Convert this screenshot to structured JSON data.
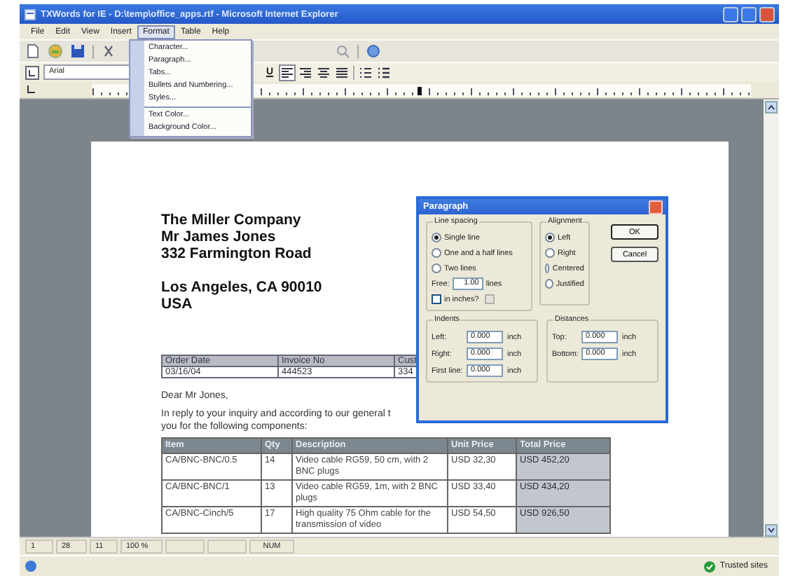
{
  "window": {
    "title": "TXWords for IE - D:\\temp\\office_apps.rtf - Microsoft Internet Explorer"
  },
  "menu_bar": [
    {
      "label": "File",
      "selected": false
    },
    {
      "label": "Edit",
      "selected": false
    },
    {
      "label": "View",
      "selected": false
    },
    {
      "label": "Insert",
      "selected": false
    },
    {
      "label": "Format",
      "selected": true
    },
    {
      "label": "Table",
      "selected": false
    },
    {
      "label": "Help",
      "selected": false
    }
  ],
  "format_menu": [
    {
      "kind": "item",
      "label": "Character..."
    },
    {
      "kind": "item",
      "label": "Paragraph..."
    },
    {
      "kind": "item",
      "label": "Tabs..."
    },
    {
      "kind": "item",
      "label": "Bullets and Numbering..."
    },
    {
      "kind": "item",
      "label": "Styles..."
    },
    {
      "kind": "separator"
    },
    {
      "kind": "item",
      "label": "Text Color..."
    },
    {
      "kind": "item",
      "label": "Background Color..."
    }
  ],
  "format_toolbar": {
    "font": "Arial",
    "underline": "U"
  },
  "document": {
    "address_lines": [
      "The Miller Company",
      "Mr James Jones",
      "332 Farmington Road"
    ],
    "city_lines": [
      "Los Angeles, CA 90010",
      "USA"
    ],
    "info_table": {
      "columns": [
        "Order Date",
        "Invoice No",
        "Cust"
      ],
      "rows": [
        [
          "03/16/04",
          "444523",
          "334"
        ]
      ]
    },
    "salutation": "Dear Mr Jones,",
    "intro_lines": [
      "In reply to your inquiry and according to our general t",
      "you for the following components:"
    ],
    "items_table": {
      "columns": [
        "Item",
        "Qty",
        "Description",
        "Unit Price",
        "Total Price"
      ],
      "rows": [
        [
          "CA/BNC-BNC/0.5",
          "14",
          "Video cable RG59, 50 cm, with 2 BNC plugs",
          "USD 32,30",
          "USD 452,20"
        ],
        [
          "CA/BNC-BNC/1",
          "13",
          "Video cable RG59, 1m, with 2 BNC plugs",
          "USD 33,40",
          "USD 434,20"
        ],
        [
          "CA/BNC-Cinch/5",
          "17",
          "High quality 75 Ohm cable for the transmission of video",
          "USD 54,50",
          "USD 926,50"
        ]
      ]
    }
  },
  "dialog": {
    "title": "Paragraph",
    "line_spacing": {
      "label": "Line spacing",
      "options": [
        {
          "label": "Single line",
          "selected": true
        },
        {
          "label": "One and a half lines",
          "selected": false
        },
        {
          "label": "Two lines",
          "selected": false
        }
      ],
      "free_label": "Free:",
      "free_value": "1.00",
      "free_unit": "lines",
      "in_inches": {
        "label": "in inches?",
        "checked": false
      },
      "exact": {
        "disabled": true
      }
    },
    "alignment": {
      "label": "Alignment",
      "options": [
        {
          "label": "Left",
          "selected": true
        },
        {
          "label": "Right",
          "selected": false
        },
        {
          "label": "Centered",
          "selected": false
        },
        {
          "label": "Justified",
          "selected": false
        }
      ]
    },
    "buttons": [
      "OK",
      "Cancel"
    ],
    "indents": {
      "label": "Indents",
      "fields": [
        {
          "label": "Left:",
          "value": "0.000",
          "unit": "inch"
        },
        {
          "label": "Right:",
          "value": "0.000",
          "unit": "inch"
        },
        {
          "label": "First line:",
          "value": "0.000",
          "unit": "inch"
        }
      ]
    },
    "distances": {
      "label": "Distances",
      "fields": [
        {
          "label": "Top:",
          "value": "0.000",
          "unit": "inch"
        },
        {
          "label": "Bottom:",
          "value": "0.000",
          "unit": "inch"
        }
      ]
    }
  },
  "status_bar": {
    "line": "1",
    "column": "28",
    "page": "11",
    "zoom": "100 %",
    "num": "NUM"
  },
  "ie_status": {
    "zone": "Trusted sites"
  }
}
